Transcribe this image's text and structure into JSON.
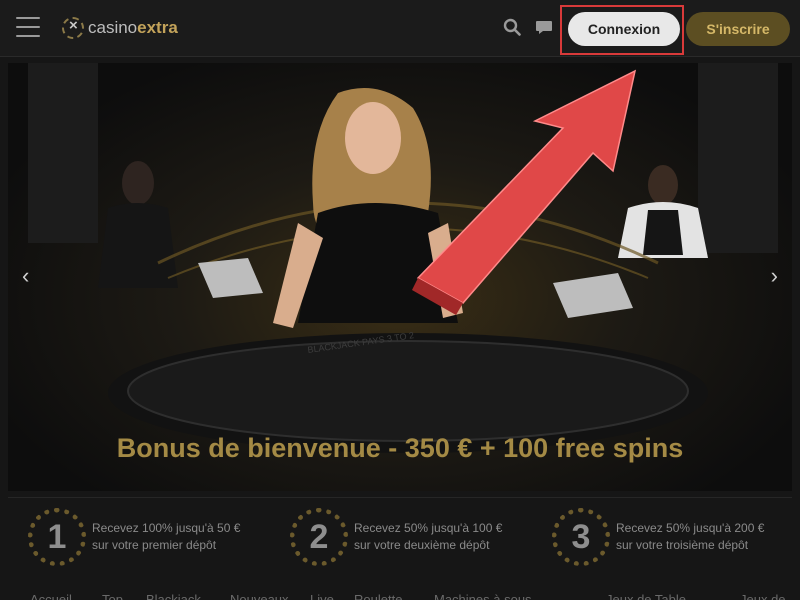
{
  "header": {
    "logo_prefix": "casino",
    "logo_suffix": "extra",
    "login_label": "Connexion",
    "signup_label": "S'inscrire"
  },
  "hero": {
    "bonus_title": "Bonus de bienvenue - 350 € + 100 free spins",
    "prev_label": "‹",
    "next_label": "›"
  },
  "steps": [
    {
      "number": "1",
      "line1": "Recevez 100% jusqu'à 50 €",
      "line2": "sur votre premier dépôt"
    },
    {
      "number": "2",
      "line1": "Recevez 50% jusqu'à 100 €",
      "line2": "sur votre deuxième dépôt"
    },
    {
      "number": "3",
      "line1": "Recevez 50% jusqu'à 200 €",
      "line2": "sur votre troisième dépôt"
    }
  ],
  "bottom_nav": [
    "Accueil",
    "Top",
    "Blackjack",
    "Nouveaux",
    "Live",
    "Roulette",
    "Machines à sous",
    "Jeux de Table",
    "Jeux de"
  ],
  "colors": {
    "gold": "#a48a45",
    "annotation_red": "#d93a3a",
    "login_bg": "#e8e8e8",
    "signup_bg": "#5c4e22"
  }
}
